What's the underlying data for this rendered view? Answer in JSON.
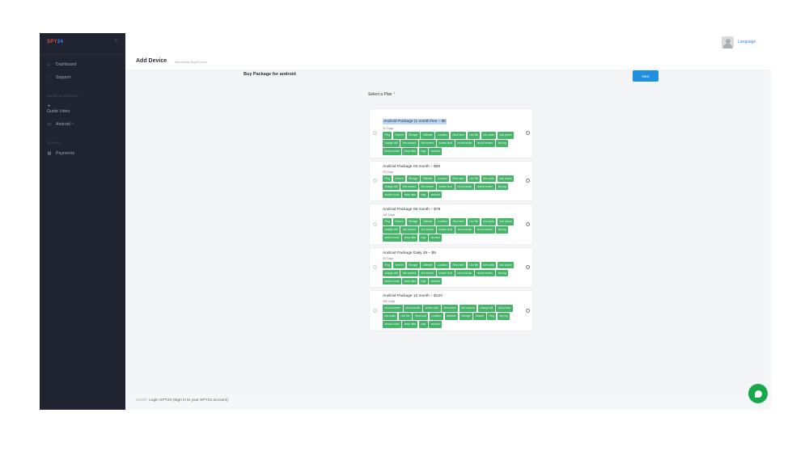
{
  "sidebar": {
    "logo_a": "SPY",
    "logo_b": "24",
    "toggle_icon": "menu-icon",
    "items": [
      {
        "label": "Dashboard",
        "icon": "home-icon",
        "glyph": "⌂"
      },
      {
        "label": "Support",
        "icon": "support-icon",
        "glyph": "◌"
      }
    ],
    "section1": "GUIDE & UPDATES",
    "guide": {
      "label": "Guide Video",
      "glyph": "▸"
    },
    "android": {
      "label": "Android ~",
      "glyph": "▭"
    },
    "section2": "BILLING",
    "payments": {
      "label": "Payments",
      "glyph": "▤"
    }
  },
  "topbar": {
    "language": "Language"
  },
  "header": {
    "title": "Add Device",
    "subtitle": "http://www.Spy24.com"
  },
  "main": {
    "buy_title": "Buy Package for android",
    "next_label": "Next",
    "select_label": "Select a Plan",
    "required_mark": "*"
  },
  "plans": [
    {
      "name": "Android Package (1 month free – $0",
      "days": "31 Days",
      "highlighted": true,
      "tags": [
        "Ping",
        "Search",
        "Storage",
        "Ultimate",
        "Location",
        "Send sms",
        "Live file",
        "live audio",
        "lock phone",
        "change wifi",
        "live camera",
        "live screen",
        "screen shot",
        "record audio",
        "record screen",
        "key log",
        "device count",
        "keep data",
        "logs",
        "account"
      ]
    },
    {
      "name": "Android Package 03 month – $50",
      "days": "93 Days",
      "highlighted": false,
      "tags": [
        "Ping",
        "Search",
        "Storage",
        "Ultimate",
        "Location",
        "Send sms",
        "Live file",
        "live audio",
        "lock phone",
        "change wifi",
        "live camera",
        "live screen",
        "screen shot",
        "record audio",
        "record screen",
        "key log",
        "device count",
        "keep data",
        "logs",
        "account"
      ]
    },
    {
      "name": "Android Package 06 month – $78",
      "days": "180 Days",
      "highlighted": false,
      "tags": [
        "Ping",
        "Search",
        "Storage",
        "Ultimate",
        "Location",
        "Send sms",
        "Live file",
        "live audio",
        "lock phone",
        "change wifi",
        "live camera",
        "live screen",
        "screen shot",
        "record audio",
        "record screen",
        "key log",
        "device count",
        "keep data",
        "logs",
        "account"
      ]
    },
    {
      "name": "Android Package Daily 45 – $5",
      "days": "45 Days",
      "highlighted": false,
      "tags": [
        "Ping",
        "Search",
        "Storage",
        "Ultimate",
        "Location",
        "Send sms",
        "Live file",
        "live audio",
        "lock phone",
        "change wifi",
        "live camera",
        "live screen",
        "screen shot",
        "record audio",
        "record screen",
        "key log",
        "device count",
        "keep data",
        "logs",
        "account"
      ]
    },
    {
      "name": "Android Package 12 month – $120",
      "days": "365 Days",
      "highlighted": false,
      "tags": [
        "record screen",
        "record audio",
        "screen shot",
        "live screen",
        "live camera",
        "change wifi",
        "lock phone",
        "live audio",
        "Live file",
        "Send sms",
        "Location",
        "Ultimate",
        "Storage",
        "Search",
        "Ping",
        "key log",
        "device count",
        "keep data",
        "logs",
        "account"
      ]
    }
  ],
  "footer": {
    "year": "2020©",
    "text": "Login SPY24 (Sign in to your SPY24 account)"
  },
  "chat": {
    "icon": "chat-icon"
  }
}
